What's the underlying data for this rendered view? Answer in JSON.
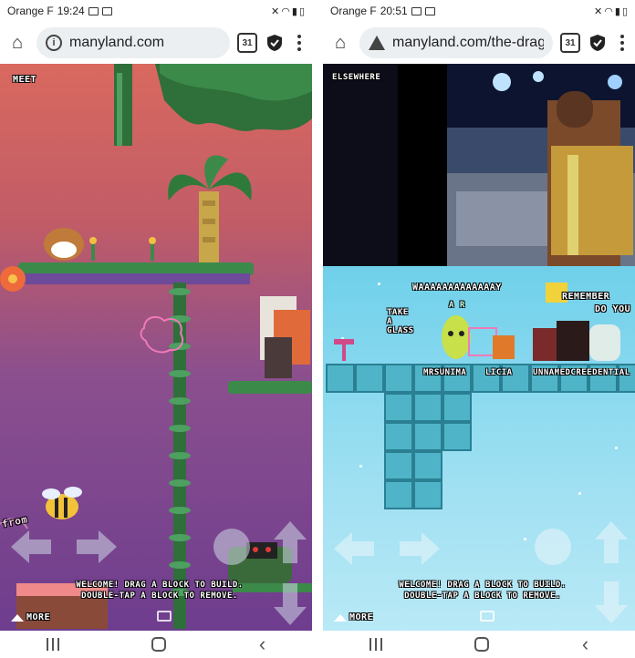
{
  "left": {
    "status": {
      "carrier": "Orange F",
      "time": "19:24"
    },
    "url": "manyland.com",
    "tab_count": "31",
    "game": {
      "top_label": "MEET",
      "welcome_line1": "WELCOME! DRAG A BLOCK TO BUILD.",
      "welcome_line2": "DOUBLE-TAP A BLOCK TO REMOVE.",
      "more": "MORE",
      "sign_text": "from"
    }
  },
  "right": {
    "status": {
      "carrier": "Orange F",
      "time": "20:51"
    },
    "url": "manyland.com/the-drag",
    "tab_count": "31",
    "game": {
      "top_label": "ELSEWHERE",
      "shout": "WAAAAAAAAAAAAAY",
      "take_a_glass": [
        "TAKE",
        "A",
        "GLASS"
      ],
      "remember": "REMEMBER",
      "do_you": "DO YOU",
      "name_tags": [
        "MRSUNIMA",
        "LICIA",
        "UNNAMEDCREEDENTIAL"
      ],
      "welcome_line1": "WELCOME! DRAG A BLOCK TO BUILD.",
      "welcome_line2": "DOUBLE-TAP A BLOCK TO REMOVE.",
      "more": "MORE",
      "small_tag": "A R"
    }
  },
  "colors": {
    "left_sky_top": "#d9695f",
    "left_bottom": "#6e3d8e",
    "right_sky": "#6fd0ea",
    "block_teal": "#4fb4c8",
    "leaf_green": "#3b8a4a"
  },
  "icons": [
    "home-icon",
    "info-icon",
    "warning-icon",
    "tabs-icon",
    "shield-icon",
    "menu-icon",
    "recent-apps-icon",
    "nav-home-icon",
    "back-icon"
  ]
}
